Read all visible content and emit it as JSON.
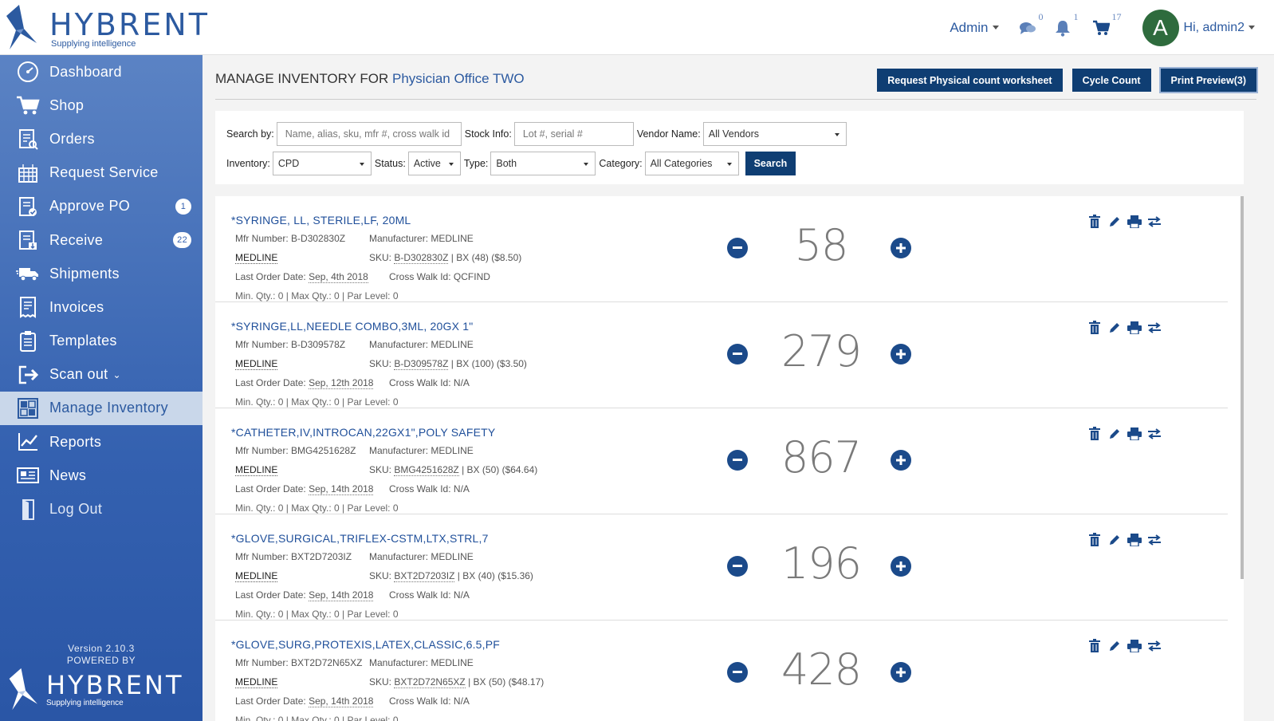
{
  "brand": {
    "name": "HYBRENT",
    "tagline": "Supplying intelligence"
  },
  "header": {
    "admin_label": "Admin",
    "messages_count": "0",
    "notifications_count": "1",
    "cart_count": "17",
    "avatar_letter": "A",
    "greeting": "Hi, admin2"
  },
  "sidebar": {
    "items": [
      {
        "label": "Dashboard",
        "icon": "dashboard-icon"
      },
      {
        "label": "Shop",
        "icon": "cart-icon"
      },
      {
        "label": "Orders",
        "icon": "orders-icon"
      },
      {
        "label": "Request Service",
        "icon": "service-icon"
      },
      {
        "label": "Approve PO",
        "icon": "approve-icon",
        "badge": "1"
      },
      {
        "label": "Receive",
        "icon": "receive-icon",
        "badge": "22"
      },
      {
        "label": "Shipments",
        "icon": "truck-icon"
      },
      {
        "label": "Invoices",
        "icon": "invoice-icon"
      },
      {
        "label": "Templates",
        "icon": "templates-icon"
      },
      {
        "label": "Scan out",
        "icon": "scan-out-icon"
      },
      {
        "label": "Manage Inventory",
        "icon": "inventory-icon"
      },
      {
        "label": "Reports",
        "icon": "reports-icon"
      },
      {
        "label": "News",
        "icon": "news-icon"
      },
      {
        "label": "Log Out",
        "icon": "logout-icon"
      }
    ],
    "active": "Manage Inventory",
    "version": "Version 2.10.3",
    "powered_by": "POWERED BY"
  },
  "page": {
    "title_prefix": "MANAGE INVENTORY FOR",
    "location": "Physician Office TWO",
    "buttons": {
      "worksheet": "Request Physical count worksheet",
      "cycle": "Cycle Count",
      "print": "Print Preview(3)"
    }
  },
  "search": {
    "search_by_label": "Search by:",
    "search_by_placeholder": "Name, alias, sku, mfr #, cross walk id",
    "stock_label": "Stock Info:",
    "stock_placeholder": "Lot #, serial #",
    "vendor_label": "Vendor Name:",
    "vendor_value": "All Vendors",
    "inventory_label": "Inventory:",
    "inventory_value": "CPD",
    "status_label": "Status:",
    "status_value": "Active",
    "type_label": "Type:",
    "type_value": "Both",
    "category_label": "Category:",
    "category_value": "All Categories",
    "search_button": "Search"
  },
  "labels": {
    "mfr_number": "Mfr Number:",
    "manufacturer": "Manufacturer:",
    "sku": "SKU:",
    "last_order": "Last Order Date:",
    "cross_walk": "Cross Walk Id:",
    "minmax": "Min. Qty.: 0 | Max Qty.: 0 | Par Level: 0"
  },
  "items": [
    {
      "name": "*SYRINGE, LL, STERILE,LF, 20ML",
      "mfr": "B-D302830Z",
      "manufacturer": "MEDLINE",
      "vendor": "MEDLINE",
      "sku": "B-D302830Z",
      "uom": "BX",
      "pack": "(48) ($8.50)",
      "last_order": "Sep, 4th 2018",
      "cross_walk": "QCFIND",
      "qty": "58"
    },
    {
      "name": "*SYRINGE,LL,NEEDLE COMBO,3ML, 20GX 1\"",
      "mfr": "B-D309578Z",
      "manufacturer": "MEDLINE",
      "vendor": "MEDLINE",
      "sku": "B-D309578Z",
      "uom": "BX",
      "pack": "(100) ($3.50)",
      "last_order": "Sep, 12th 2018",
      "cross_walk": "N/A",
      "qty": "279"
    },
    {
      "name": "*CATHETER,IV,INTROCAN,22GX1\",POLY SAFETY",
      "mfr": "BMG4251628Z",
      "manufacturer": "MEDLINE",
      "vendor": "MEDLINE",
      "sku": "BMG4251628Z",
      "uom": "BX",
      "pack": "(50) ($64.64)",
      "last_order": "Sep, 14th 2018",
      "cross_walk": "N/A",
      "qty": "867"
    },
    {
      "name": "*GLOVE,SURGICAL,TRIFLEX-CSTM,LTX,STRL,7",
      "mfr": "BXT2D7203IZ",
      "manufacturer": "MEDLINE",
      "vendor": "MEDLINE",
      "sku": "BXT2D7203IZ",
      "uom": "BX",
      "pack": "(40) ($15.36)",
      "last_order": "Sep, 14th 2018",
      "cross_walk": "N/A",
      "qty": "196"
    },
    {
      "name": "*GLOVE,SURG,PROTEXIS,LATEX,CLASSIC,6.5,PF",
      "mfr": "BXT2D72N65XZ",
      "manufacturer": "MEDLINE",
      "vendor": "MEDLINE",
      "sku": "BXT2D72N65XZ",
      "uom": "BX",
      "pack": "(50) ($48.17)",
      "last_order": "Sep, 14th 2018",
      "cross_walk": "N/A",
      "qty": "428"
    }
  ],
  "colors": {
    "primary": "#0f3e73",
    "link": "#1f4f9a",
    "sidebar": "#3461b0"
  }
}
